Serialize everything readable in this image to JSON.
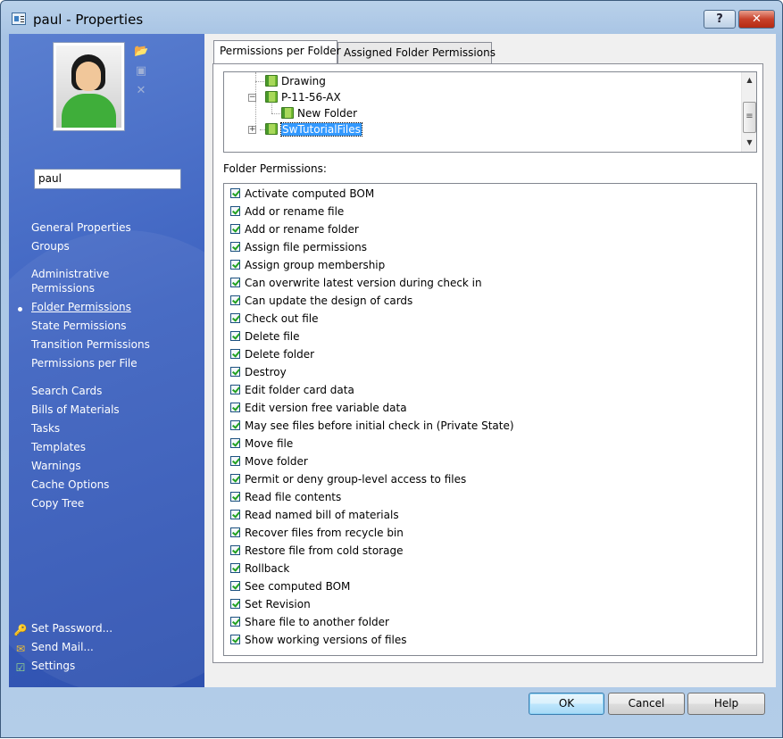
{
  "window": {
    "title": "paul - Properties",
    "help_glyph": "?",
    "close_glyph": "✕"
  },
  "sidebar": {
    "username": "paul",
    "nav_group1": [
      {
        "label": "General Properties"
      },
      {
        "label": "Groups"
      }
    ],
    "nav_group2": [
      {
        "label": "Administrative"
      },
      {
        "label": "Permissions"
      },
      {
        "label": "Folder Permissions",
        "active": true
      },
      {
        "label": "State Permissions"
      },
      {
        "label": "Transition Permissions"
      },
      {
        "label": "Permissions per File"
      }
    ],
    "nav_group3": [
      {
        "label": "Search Cards"
      },
      {
        "label": "Bills of Materials"
      },
      {
        "label": "Tasks"
      },
      {
        "label": "Templates"
      },
      {
        "label": "Warnings"
      },
      {
        "label": "Cache Options"
      },
      {
        "label": "Copy Tree"
      }
    ],
    "actions": [
      {
        "label": "Set Password...",
        "icon": "key-icon"
      },
      {
        "label": "Send Mail...",
        "icon": "mail-icon"
      },
      {
        "label": "Settings",
        "icon": "settings-icon"
      }
    ]
  },
  "tabs": [
    {
      "label": "Permissions per Folder",
      "selected": true
    },
    {
      "label": "Assigned Folder Permissions",
      "selected": false
    }
  ],
  "tree": [
    {
      "label": "Drawing"
    },
    {
      "label": "P-11-56-AX",
      "expander": "−"
    },
    {
      "label": "New Folder"
    },
    {
      "label": "SwTutorialFiles",
      "expander": "+",
      "selected": true
    }
  ],
  "scroll": {
    "up": "▲",
    "down": "▼",
    "grip": "≡"
  },
  "folder_permissions_label": "Folder Permissions:",
  "permissions": [
    {
      "label": "Activate computed BOM",
      "checked": true
    },
    {
      "label": "Add or rename file",
      "checked": true
    },
    {
      "label": "Add or rename folder",
      "checked": true
    },
    {
      "label": "Assign file permissions",
      "checked": true
    },
    {
      "label": "Assign group membership",
      "checked": true
    },
    {
      "label": "Can overwrite latest version during check in",
      "checked": true
    },
    {
      "label": "Can update the design of cards",
      "checked": true
    },
    {
      "label": "Check out file",
      "checked": true
    },
    {
      "label": "Delete file",
      "checked": true
    },
    {
      "label": "Delete folder",
      "checked": true
    },
    {
      "label": "Destroy",
      "checked": true
    },
    {
      "label": "Edit folder card data",
      "checked": true
    },
    {
      "label": "Edit version free variable data",
      "checked": true
    },
    {
      "label": "May see files before initial check in (Private State)",
      "checked": true
    },
    {
      "label": "Move file",
      "checked": true
    },
    {
      "label": "Move folder",
      "checked": true
    },
    {
      "label": "Permit or deny group-level access to files",
      "checked": true
    },
    {
      "label": "Read file contents",
      "checked": true
    },
    {
      "label": "Read named bill of materials",
      "checked": true
    },
    {
      "label": "Recover files from recycle bin",
      "checked": true
    },
    {
      "label": "Restore file from cold storage",
      "checked": true
    },
    {
      "label": "Rollback",
      "checked": true
    },
    {
      "label": "See computed BOM",
      "checked": true
    },
    {
      "label": "Set Revision",
      "checked": true
    },
    {
      "label": "Share file to another folder",
      "checked": true
    },
    {
      "label": "Show working versions of files",
      "checked": true
    }
  ],
  "buttons": {
    "ok": "OK",
    "cancel": "Cancel",
    "help": "Help"
  }
}
